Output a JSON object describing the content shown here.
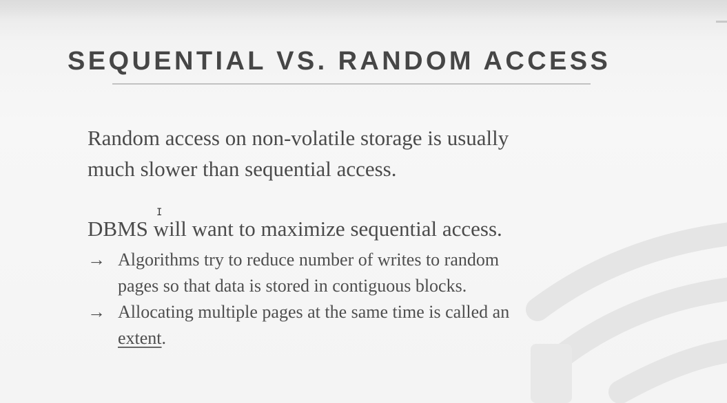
{
  "slide": {
    "title": "SEQUENTIAL VS. RANDOM ACCESS",
    "paragraph1": {
      "line1": "Random access on non-volatile storage is usually",
      "line2": "much slower than sequential access."
    },
    "paragraph2": "DBMS will want to maximize sequential access.",
    "bullets": [
      {
        "arrow": "→",
        "line1": "Algorithms try to reduce number of writes to random",
        "line2": "pages so that data is stored in contiguous blocks."
      },
      {
        "arrow": "→",
        "line1": "Allocating multiple pages at the same time is called an",
        "line2_term": "extent",
        "line2_suffix": "."
      }
    ]
  },
  "icons": {
    "watermark": "database-cylinder-icon",
    "cursor": "text-cursor-icon"
  },
  "colors": {
    "title": "#464646",
    "body_text": "#4a4a4a",
    "rule": "#c2c2c2",
    "background": "#f5f5f5",
    "watermark": "#e6e6e6"
  }
}
